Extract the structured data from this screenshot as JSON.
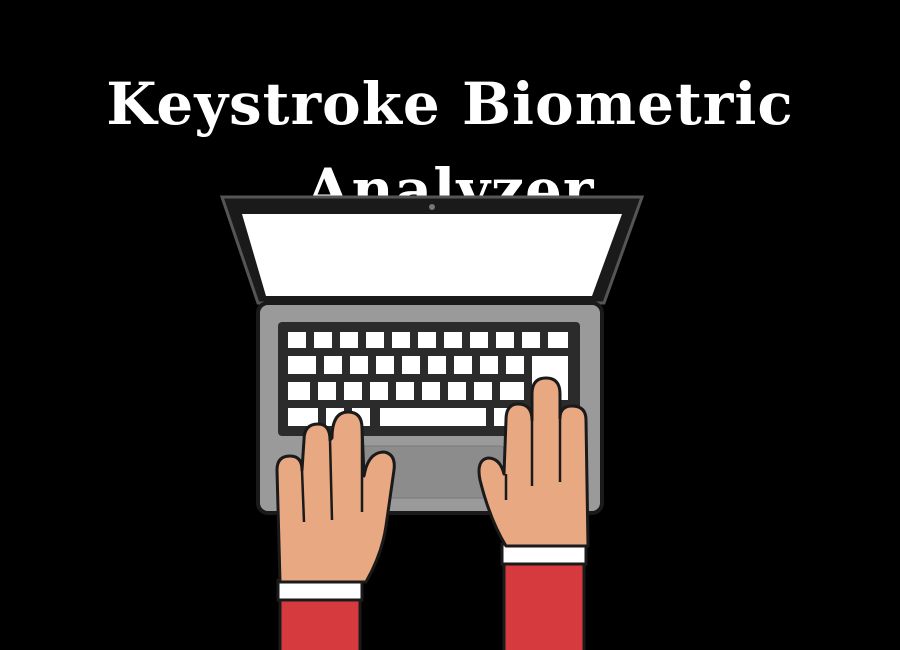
{
  "title": {
    "line1": "Keystroke Biometric",
    "line2": "Analyzer"
  },
  "colors": {
    "background": "#000000",
    "text": "#ffffff",
    "laptop_body": "#9a9a9a",
    "screen": "#ffffff",
    "keyboard": "#2b2b2b",
    "keys": "#ffffff",
    "skin": "#e8a882",
    "sleeve": "#d63a3f",
    "cuff": "#ffffff",
    "outline": "#1a1a1a"
  },
  "illustration": {
    "subject": "laptop-with-typing-hands",
    "icons": [
      "laptop-icon",
      "left-hand-icon",
      "right-hand-icon"
    ]
  }
}
